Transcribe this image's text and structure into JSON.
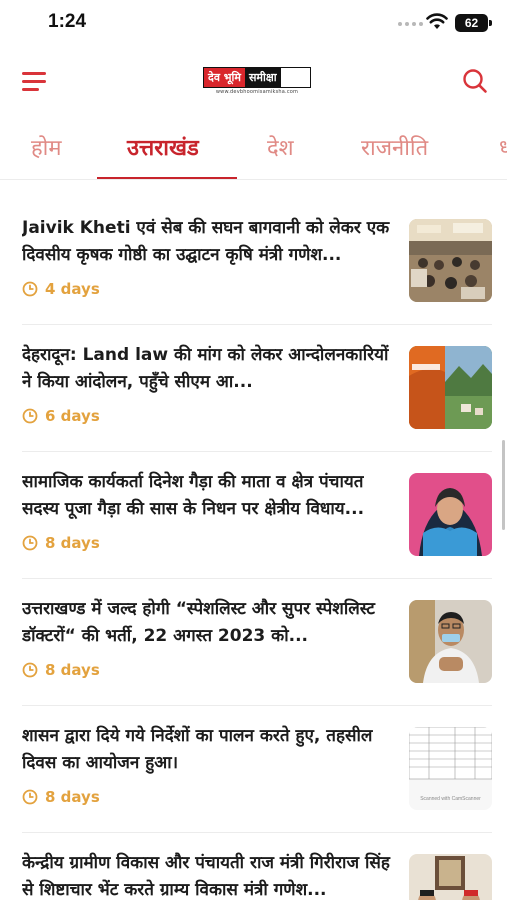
{
  "status": {
    "time": "1:24",
    "battery": "62"
  },
  "header": {
    "logo_left": "देव भूमि",
    "logo_right": "समीक्षा",
    "logo_url": "www.devbhoomisamiksha.com"
  },
  "tabs": [
    {
      "label": "होम",
      "active": false
    },
    {
      "label": "उत्तराखंड",
      "active": true
    },
    {
      "label": "देश",
      "active": false
    },
    {
      "label": "राजनीति",
      "active": false
    },
    {
      "label": "धा",
      "active": false
    }
  ],
  "articles": [
    {
      "title": "Jaivik Kheti एवं सेब की सघन बागवानी को लेकर एक दिवसीय कृषक गोष्ठी का उद्घाटन कृषि मंत्री गणेश...",
      "time": "4 days"
    },
    {
      "title": "देहरादून: Land law की मांग को लेकर आन्दोलनकारियों ने किया आंदोलन, पहुँचे सीएम आ...",
      "time": "6 days"
    },
    {
      "title": "सामाजिक कार्यकर्ता दिनेश गैड़ा की माता व क्षेत्र पंचायत सदस्य पूजा गैड़ा की सास के निधन पर क्षेत्रीय विधाय...",
      "time": "8 days"
    },
    {
      "title": "उत्तराखण्ड में जल्द होगी “स्पेशलिस्ट और सुपर स्पेशलिस्ट डॉक्टरों“ की भर्ती, 22 अगस्त 2023 को...",
      "time": "8 days"
    },
    {
      "title": "शासन द्वारा दिये गये निर्देशों का पालन करते हुए, तहसील दिवस का आयोजन हुआ।",
      "time": "8 days",
      "thumb_caption": "Scanned with CamScanner"
    },
    {
      "title": "केन्द्रीय ग्रामीण विकास और पंचायती राज मंत्री गिरीराज सिंह से शिष्टाचार भेंट करते ग्राम्य विकास मंत्री गणेश...",
      "time": ""
    }
  ],
  "colors": {
    "accent": "#c8242c",
    "tab_inactive": "#e08a85",
    "time": "#e3a23e"
  }
}
